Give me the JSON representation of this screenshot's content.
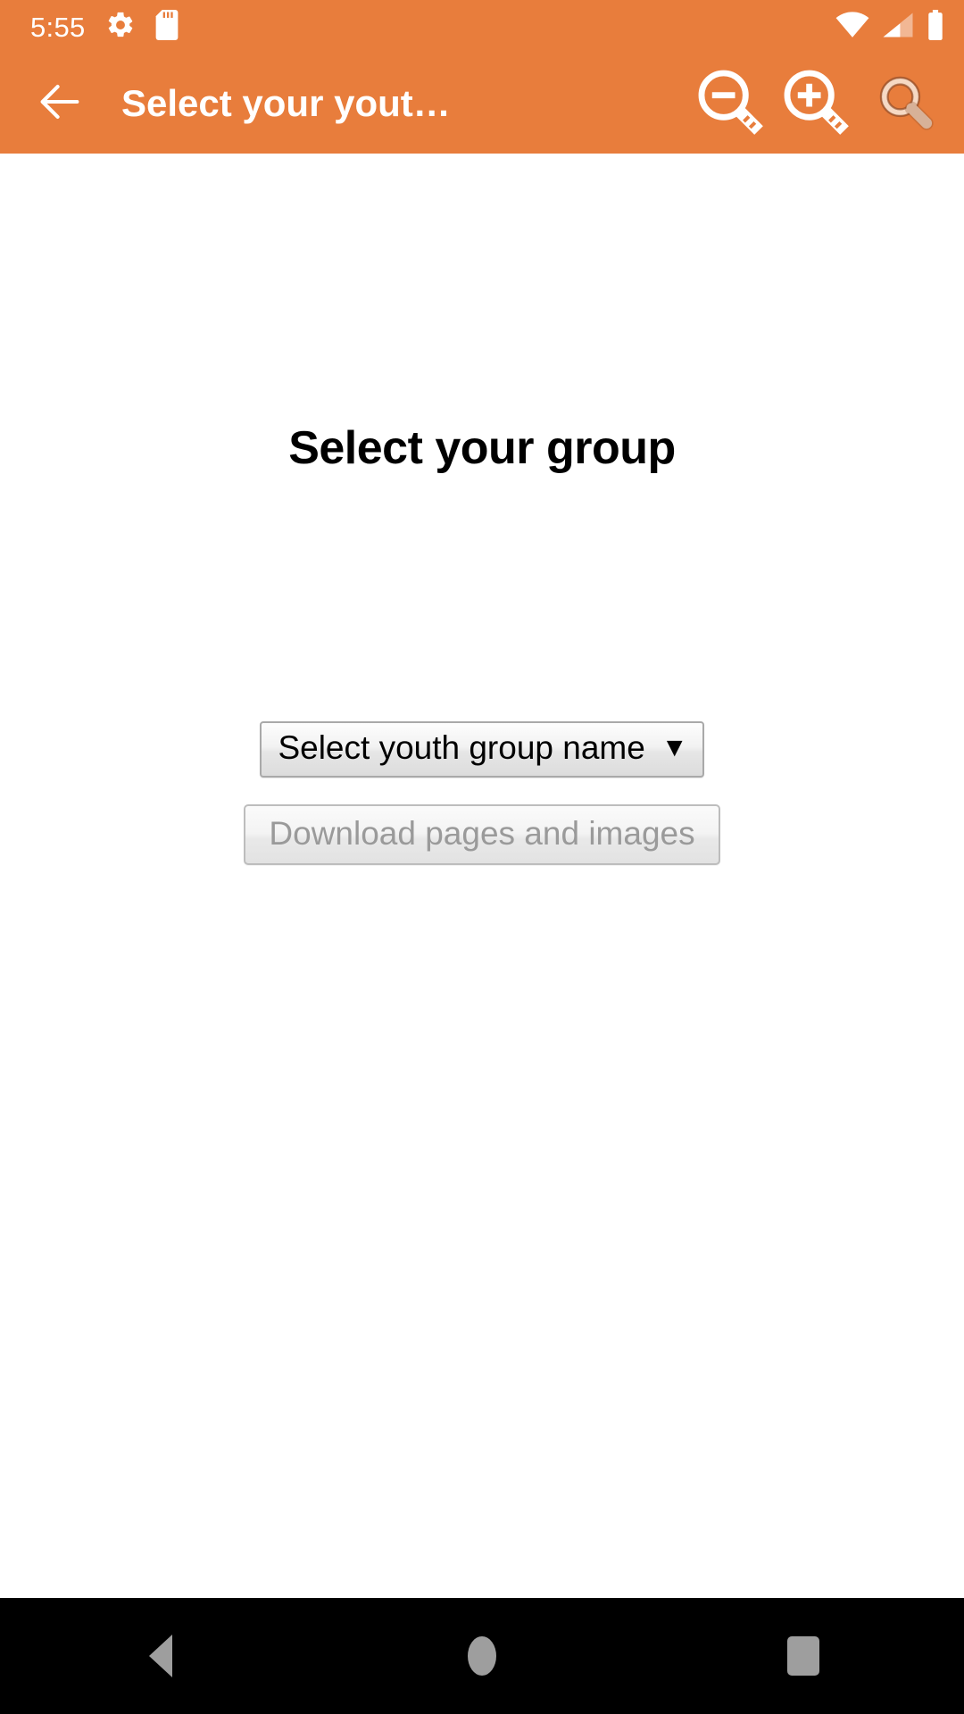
{
  "status_bar": {
    "time": "5:55",
    "icons_left": [
      "gear-icon",
      "sd-card-icon"
    ],
    "icons_right": [
      "wifi-icon",
      "cellular-signal-icon",
      "battery-icon"
    ],
    "background_color": "#E87D3C",
    "foreground_color": "#FFFFFF"
  },
  "app_bar": {
    "back_label": "back-arrow-icon",
    "title": "Select your yout…",
    "actions": [
      {
        "name": "zoom-out-icon",
        "label": "Zoom out"
      },
      {
        "name": "zoom-in-icon",
        "label": "Zoom in"
      },
      {
        "name": "search-icon",
        "label": "Search"
      }
    ],
    "background_color": "#E87D3C",
    "title_color": "#FFFFFF"
  },
  "main": {
    "heading": "Select your group",
    "select": {
      "selected_value": "Select youth group name",
      "caret": "▼",
      "options": [
        "Select youth group name"
      ]
    },
    "download_button": {
      "label": "Download pages and images",
      "disabled": true,
      "text_color": "#9A9A9A"
    }
  },
  "nav_bar": {
    "background_color": "#000000",
    "buttons": [
      {
        "name": "nav-back-button",
        "label": "Back"
      },
      {
        "name": "nav-home-button",
        "label": "Home"
      },
      {
        "name": "nav-recents-button",
        "label": "Recents"
      }
    ]
  }
}
